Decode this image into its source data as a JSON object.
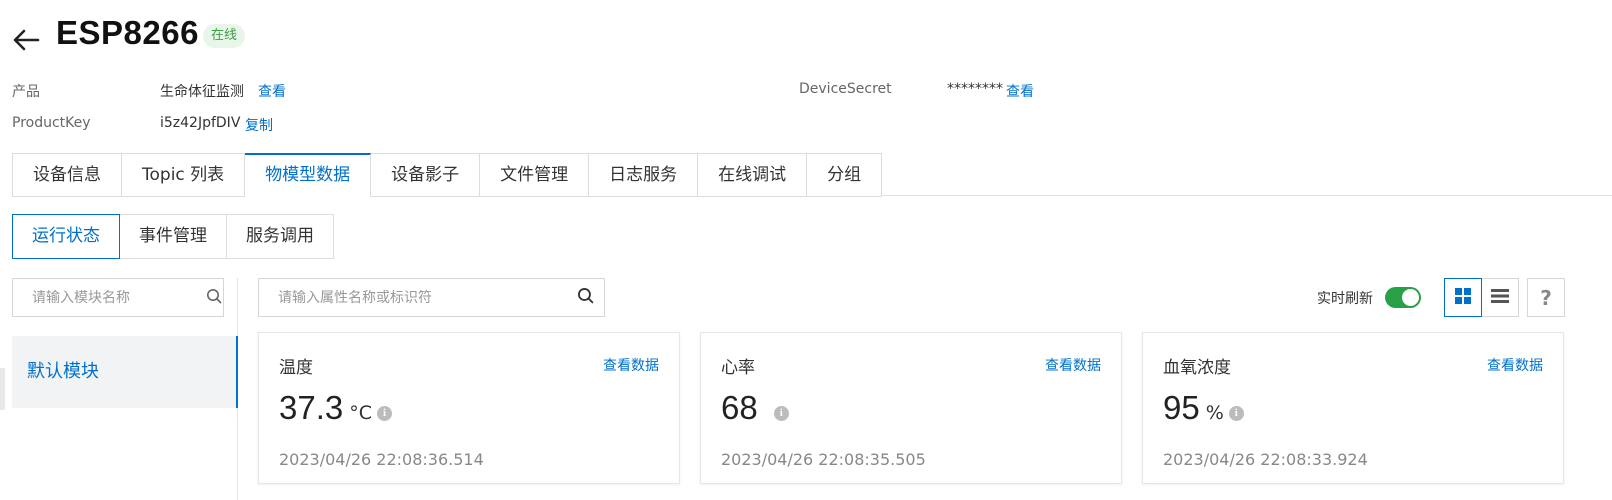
{
  "header": {
    "title": "ESP8266",
    "status": "在线"
  },
  "meta": {
    "product_label": "产品",
    "product_value": "生命体征监测",
    "product_link": "查看",
    "productkey_label": "ProductKey",
    "productkey_value": "i5z42JpfDIV",
    "productkey_link": "复制",
    "secret_label": "DeviceSecret",
    "secret_value": "********",
    "secret_link": "查看"
  },
  "tabs": [
    "设备信息",
    "Topic 列表",
    "物模型数据",
    "设备影子",
    "文件管理",
    "日志服务",
    "在线调试",
    "分组"
  ],
  "subtabs": [
    "运行状态",
    "事件管理",
    "服务调用"
  ],
  "sidebar": {
    "search_placeholder": "请输入模块名称",
    "module": "默认模块"
  },
  "main": {
    "search_placeholder": "请输入属性名称或标识符",
    "realtime_label": "实时刷新",
    "realtime_on": true,
    "help_label": "?"
  },
  "cards": [
    {
      "name": "温度",
      "link": "查看数据",
      "value": "37.3",
      "unit": "°C",
      "timestamp": "2023/04/26 22:08:36.514"
    },
    {
      "name": "心率",
      "link": "查看数据",
      "value": "68",
      "unit": "",
      "timestamp": "2023/04/26 22:08:35.505"
    },
    {
      "name": "血氧浓度",
      "link": "查看数据",
      "value": "95",
      "unit": "%",
      "timestamp": "2023/04/26 22:08:33.924"
    }
  ],
  "colors": {
    "accent": "#0070cc",
    "online": "#3f9b49",
    "toggle": "#27a047"
  },
  "icons": [
    "back-arrow-icon",
    "search-icon",
    "info-icon",
    "grid-view-icon",
    "list-view-icon",
    "help-icon"
  ]
}
